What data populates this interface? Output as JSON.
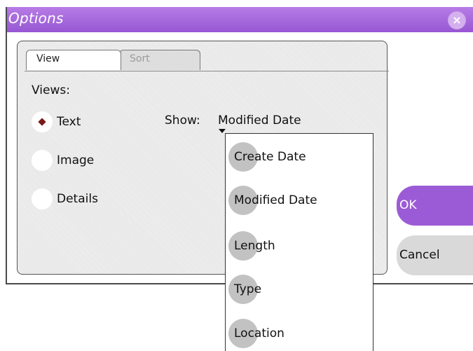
{
  "window": {
    "title": "Options",
    "close_glyph": "×"
  },
  "tabs": [
    {
      "label": "View",
      "active": true
    },
    {
      "label": "Sort",
      "active": false
    }
  ],
  "views": {
    "heading": "Views:",
    "options": [
      {
        "label": "Text",
        "selected": true
      },
      {
        "label": "Image",
        "selected": false
      },
      {
        "label": "Details",
        "selected": false
      }
    ]
  },
  "show": {
    "label": "Show:",
    "value": "Modified Date",
    "options": [
      "Create Date",
      "Modified Date",
      "Length",
      "Type",
      "Location"
    ]
  },
  "buttons": {
    "ok": "OK",
    "cancel": "Cancel"
  },
  "colors": {
    "titlebar": "#9b5bd6",
    "ok_button": "#9b5bd6",
    "cancel_button": "#d9d9d9",
    "radio_dot": "#7a1a1a"
  }
}
